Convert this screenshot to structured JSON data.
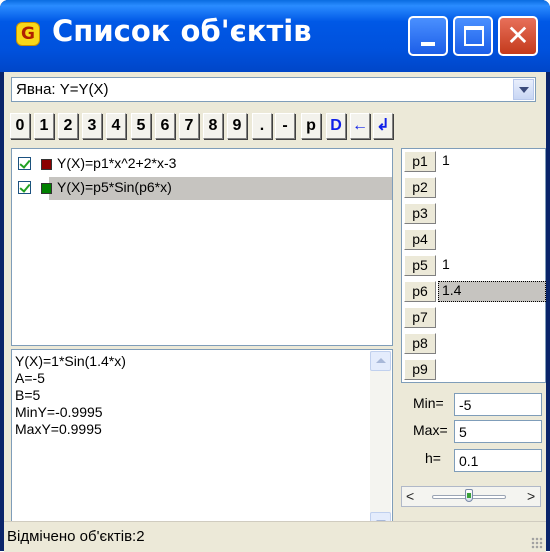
{
  "window": {
    "title": "Список об'єктів",
    "app_icon": "G",
    "controls": {
      "minimize": "minimize-icon",
      "maximize": "maximize-icon",
      "close": "close-icon",
      "close_glyph": "✕"
    }
  },
  "combo": {
    "value": "Явна: Y=Y(X)"
  },
  "keypad": [
    "0",
    "1",
    "2",
    "3",
    "4",
    "5",
    "6",
    "7",
    "8",
    "9",
    ".",
    "-",
    "p",
    "D",
    "←",
    "↲"
  ],
  "objects": [
    {
      "checked": true,
      "color": "#8b0000",
      "formula": "Y(X)=p1*x^2+2*x-3",
      "selected": false
    },
    {
      "checked": true,
      "color": "#008000",
      "formula": "Y(X)=p5*Sin(p6*x)",
      "selected": true
    }
  ],
  "info_lines": [
    "Y(X)=1*Sin(1.4*x)",
    "A=-5",
    "B=5",
    "MinY=-0.9995",
    "MaxY=0.9995"
  ],
  "params": [
    {
      "name": "p1",
      "value": "1"
    },
    {
      "name": "p2",
      "value": ""
    },
    {
      "name": "p3",
      "value": ""
    },
    {
      "name": "p4",
      "value": ""
    },
    {
      "name": "p5",
      "value": "1"
    },
    {
      "name": "p6",
      "value": "1.4",
      "selected": true
    },
    {
      "name": "p7",
      "value": ""
    },
    {
      "name": "p8",
      "value": ""
    },
    {
      "name": "p9",
      "value": ""
    }
  ],
  "range": {
    "min_label": "Min=",
    "min": "-5",
    "max_label": "Max=",
    "max": "5",
    "h_label": "h=",
    "h": "0.1"
  },
  "slider": {
    "left": "<",
    "right": ">"
  },
  "status": "Відмічено об'єктів:2"
}
